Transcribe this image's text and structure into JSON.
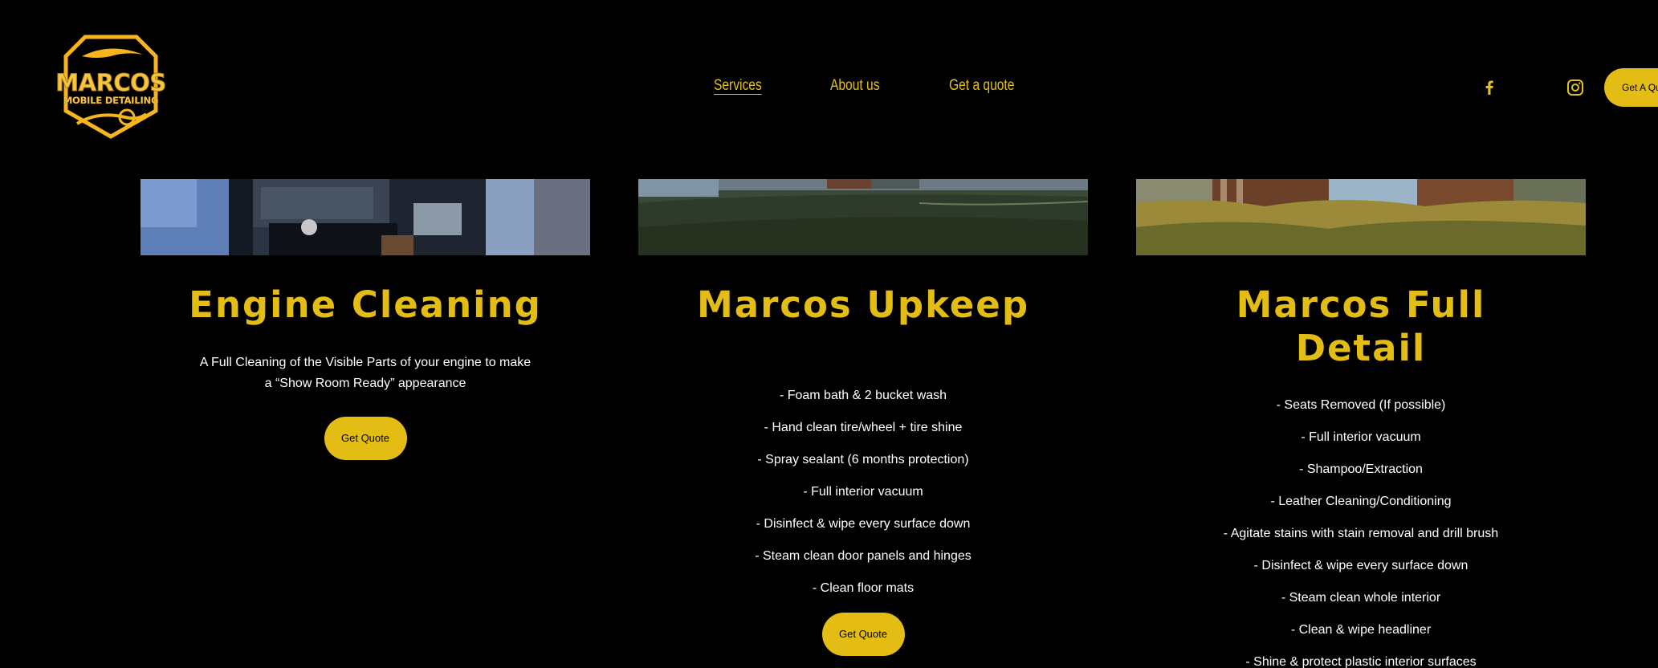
{
  "header": {
    "logo": {
      "line1": "MARCOS",
      "line2": "MOBILE DETAILING"
    },
    "nav": [
      {
        "label": "Services",
        "active": true
      },
      {
        "label": "About us",
        "active": false
      },
      {
        "label": "Get a quote",
        "active": false
      }
    ],
    "social": [
      "facebook-icon",
      "instagram-icon"
    ],
    "cta_label": "Get A Quote"
  },
  "cards": [
    {
      "title": "Engine Cleaning",
      "description": "A Full Cleaning of the Visible Parts of your engine to make a “Show Room Ready” appearance",
      "button": "Get Quote"
    },
    {
      "title": "Marcos Upkeep",
      "items": [
        "- Foam bath & 2 bucket wash",
        "- Hand clean tire/wheel + tire shine",
        "- Spray sealant (6 months protection)",
        "- Full interior vacuum",
        "- Disinfect & wipe every surface down",
        "- Steam clean door panels and hinges",
        "- Clean floor mats"
      ],
      "button": "Get Quote"
    },
    {
      "title_line1": "Marcos Full",
      "title_line2": "Detail",
      "items": [
        "- Seats Removed (If possible)",
        "- Full interior vacuum",
        "- Shampoo/Extraction",
        "- Leather Cleaning/Conditioning",
        "- Agitate stains with stain removal and drill brush",
        "- Disinfect & wipe every surface down",
        "- Steam clean whole interior",
        "- Clean & wipe headliner",
        "- Shine & protect plastic interior surfaces"
      ]
    }
  ],
  "colors": {
    "background": "#000000",
    "accent": "#e3bd14",
    "logo_gold": "#f6c542",
    "text": "#ffffff"
  }
}
